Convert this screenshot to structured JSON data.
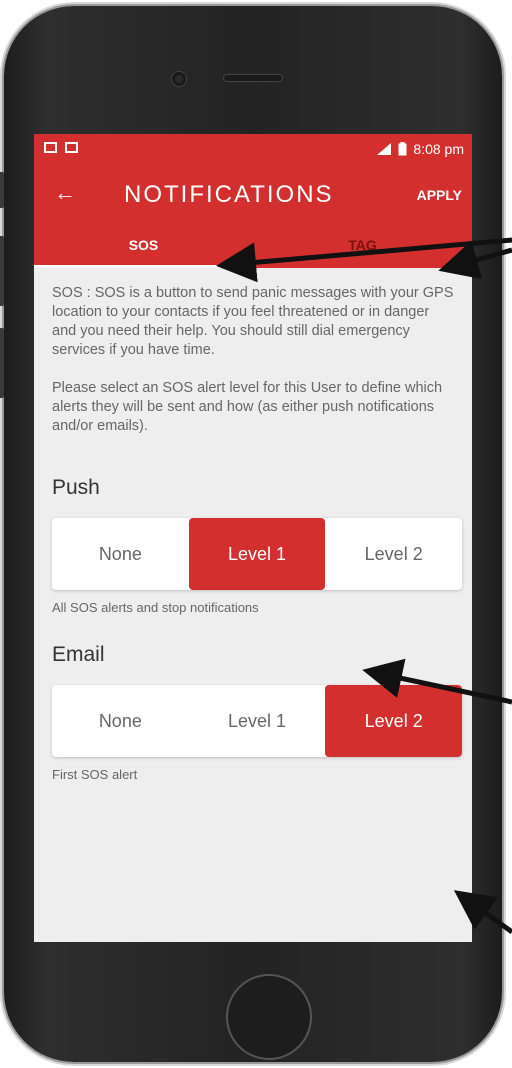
{
  "status_bar": {
    "time": "8:08 pm"
  },
  "toolbar": {
    "title": "NOTIFICATIONS",
    "apply_label": "APPLY",
    "back_icon": "arrow-left-icon"
  },
  "tabs": [
    {
      "label": "SOS",
      "selected": true
    },
    {
      "label": "TAG",
      "selected": false
    }
  ],
  "description": {
    "paragraph1": "SOS : SOS is a button to send panic messages with your GPS location to your contacts if you feel threatened or in danger and you need their help. You should still dial emergency services if you have time.",
    "paragraph2": "Please select an SOS alert level for this User to define which alerts they will be sent and how (as either push notifications and/or emails)."
  },
  "push": {
    "label": "Push",
    "options": [
      "None",
      "Level 1",
      "Level 2"
    ],
    "selected": "Level 1",
    "helper": "All SOS alerts and stop notifications"
  },
  "email": {
    "label": "Email",
    "options": [
      "None",
      "Level 1",
      "Level 2"
    ],
    "selected": "Level 2",
    "helper": "First SOS alert"
  },
  "colors": {
    "accent": "#d32f2f",
    "inactive_tab": "#7a1010",
    "background": "#eeeeee"
  }
}
